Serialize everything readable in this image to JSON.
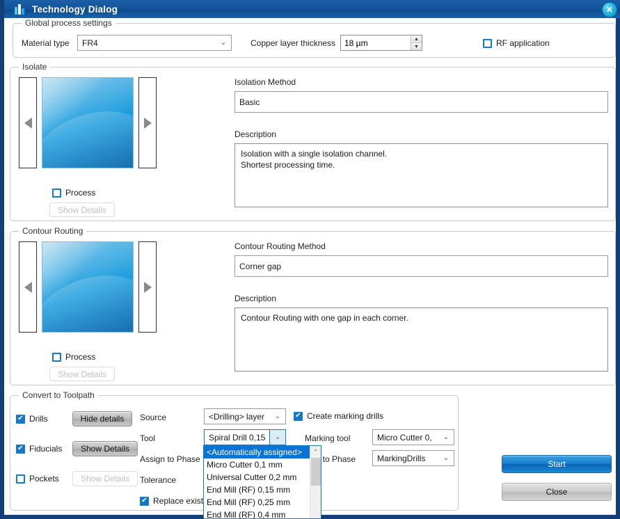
{
  "window": {
    "title": "Technology Dialog",
    "close_icon": "✕",
    "app_icon": "logo-icon"
  },
  "global": {
    "legend": "Global process settings",
    "material_label": "Material type",
    "material_value": "FR4",
    "copper_label": "Copper layer thickness",
    "copper_value": "18 µm",
    "rf_label": "RF application",
    "rf_checked": false
  },
  "isolate": {
    "legend": "Isolate",
    "process_label": "Process",
    "process_checked": false,
    "show_details_label": "Show Details",
    "show_details_enabled": false,
    "method_label": "Isolation Method",
    "method_value": "Basic",
    "description_label": "Description",
    "description_value": "Isolation with a single isolation channel.\nShortest processing time.",
    "prev_arrow": "◀",
    "next_arrow": "▶"
  },
  "contour": {
    "legend": "Contour Routing",
    "process_label": "Process",
    "process_checked": false,
    "show_details_label": "Show Details",
    "show_details_enabled": false,
    "method_label": "Contour Routing Method",
    "method_value": "Corner gap",
    "description_label": "Description",
    "description_value": "Contour Routing with one gap in each corner.",
    "prev_arrow": "◀",
    "next_arrow": "▶"
  },
  "toolpath": {
    "legend": "Convert to Toolpath",
    "drills_label": "Drills",
    "drills_checked": true,
    "drills_button": "Hide details",
    "fiducials_label": "Fiducials",
    "fiducials_checked": true,
    "fiducials_button": "Show Details",
    "pockets_label": "Pockets",
    "pockets_checked": false,
    "pockets_button": "Show Details",
    "source_label": "Source",
    "source_value": "<Drilling>  layer",
    "tool_label": "Tool",
    "tool_value": "Spiral  Drill 0,15",
    "assign_phase_label": "Assign to Phase",
    "tolerance_label": "Tolerance",
    "replace_existing_label": "Replace existing",
    "replace_existing_checked": true,
    "create_marking_drills_label": "Create marking drills",
    "create_marking_drills_checked": true,
    "marking_tool_label": "Marking tool",
    "marking_tool_value": "Micro  Cutter 0,",
    "marking_assign_label": "gn to Phase",
    "marking_assign_value": "MarkingDrills",
    "dropdown_open": true,
    "dropdown_items": [
      "<Automatically assigned>",
      "Micro Cutter 0,1 mm",
      "Universal Cutter 0,2 mm",
      "End Mill (RF) 0,15 mm",
      "End Mill (RF) 0,25 mm",
      "End Mill (RF) 0,4 mm"
    ],
    "dropdown_selected_index": 0,
    "scroll_up_icon": "⌃"
  },
  "actions": {
    "start_label": "Start",
    "close_label": "Close"
  }
}
